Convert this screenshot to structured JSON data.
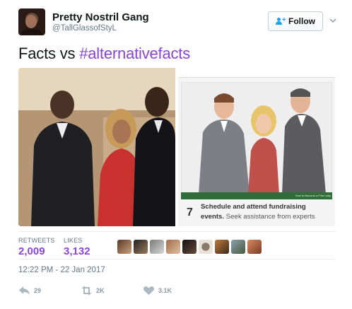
{
  "tweet": {
    "display_name": "Pretty Nostril Gang",
    "handle": "@TallGlassofStyL",
    "follow_label": "Follow",
    "text_plain": "Facts vs ",
    "hashtag": "#alternativefacts",
    "timestamp": "12:22 PM - 22 Jan 2017"
  },
  "media": {
    "right": {
      "step_number": "7",
      "step_bold_line1": "Schedule and attend fundraising",
      "step_bold_line2": "events.",
      "step_rest": " Seek assistance from experts",
      "watermark": "How to Become a First Lady"
    }
  },
  "stats": {
    "retweets_label": "RETWEETS",
    "retweets_value": "2,009",
    "likes_label": "LIKES",
    "likes_value": "3,132"
  },
  "actions": {
    "reply_count": "29",
    "retweet_count": "2K",
    "like_count": "3.1K"
  },
  "icons": {
    "follow": "person-plus-icon",
    "caret": "chevron-down-icon",
    "reply": "reply-icon",
    "retweet": "retweet-icon",
    "like": "heart-icon"
  },
  "colors": {
    "accent": "#8a44d6",
    "follow_blue": "#1da1f2",
    "meta_gray": "#657786",
    "action_gray": "#8899a6"
  }
}
